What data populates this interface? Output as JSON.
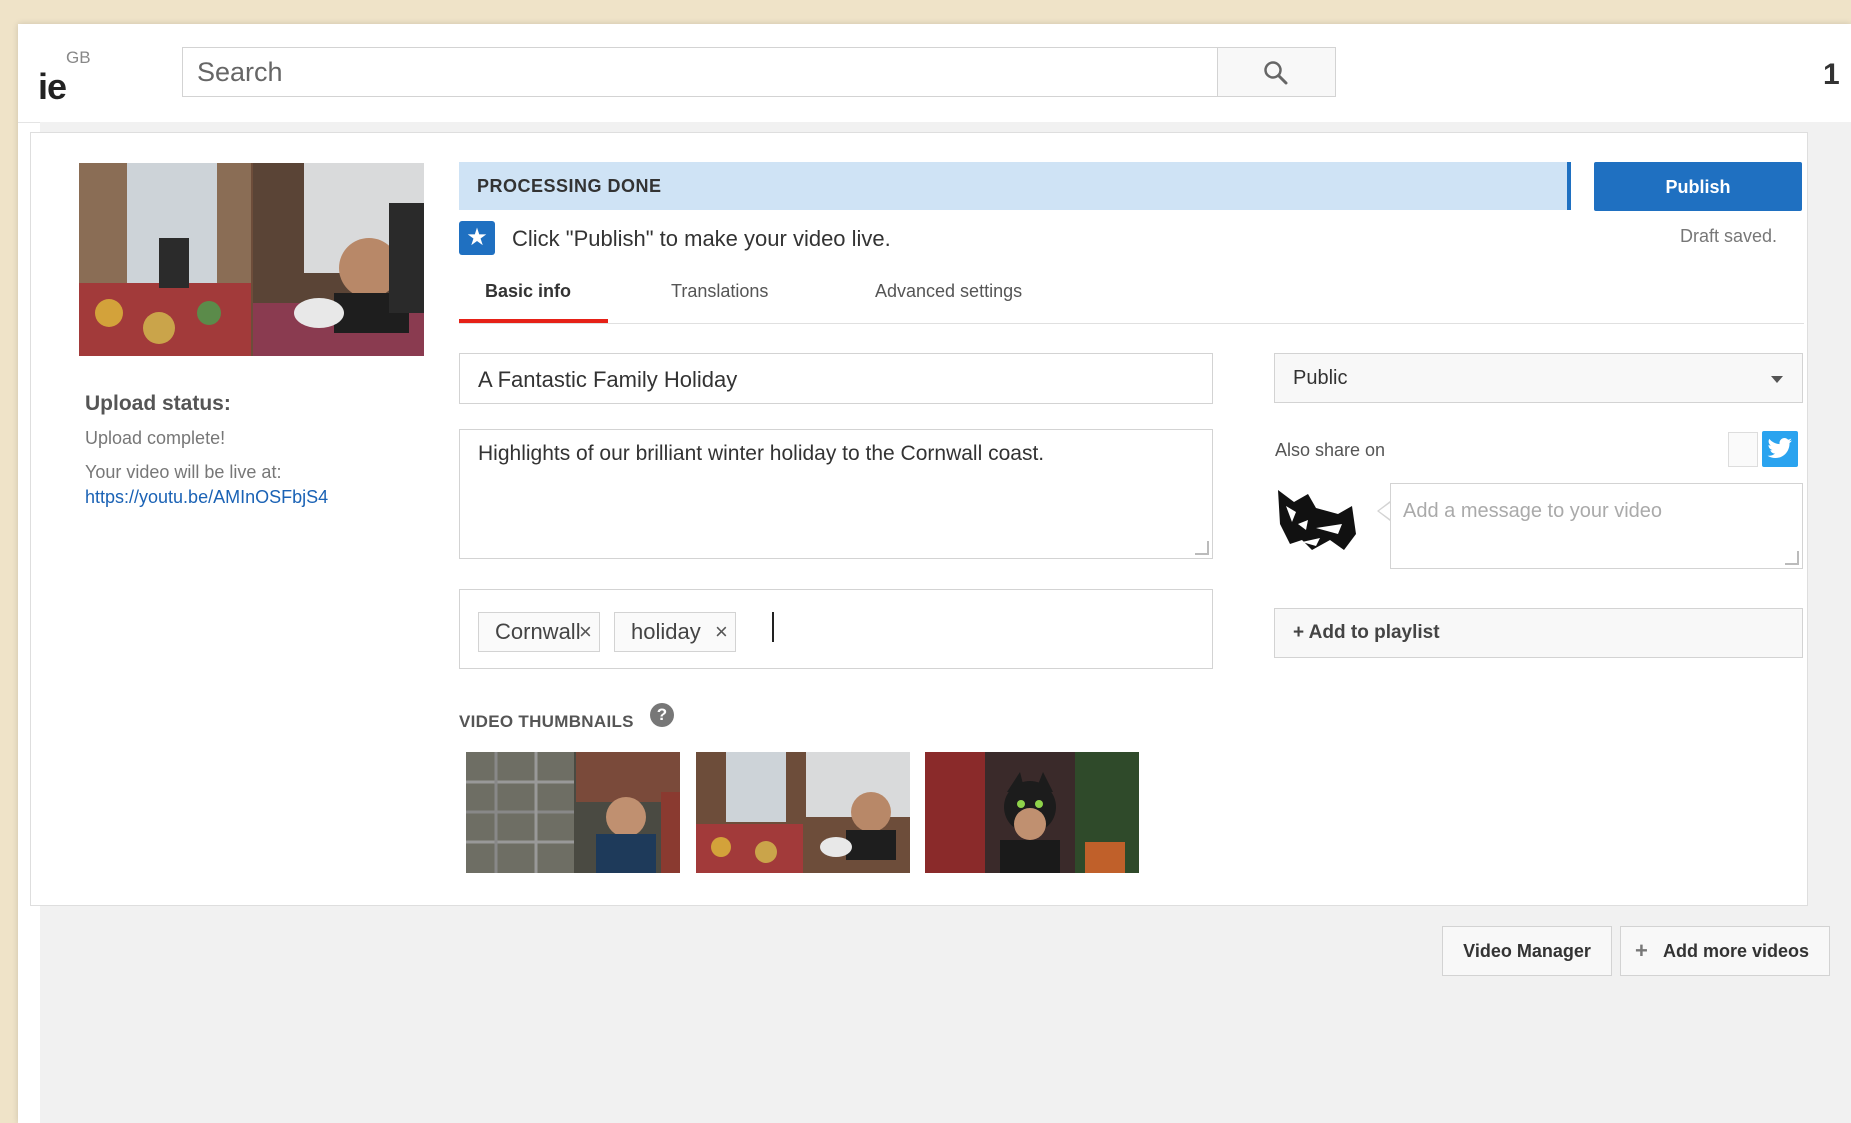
{
  "header": {
    "logo_text": "ie",
    "logo_region": "GB",
    "search_placeholder": "Search",
    "search_icon": "search-icon",
    "corner_glyph": "1"
  },
  "sidebar": {
    "upload_status_label": "Upload status:",
    "upload_complete": "Upload complete!",
    "live_at_label": "Your video will be live at:",
    "video_url": "https://youtu.be/AMInOSFbjS4"
  },
  "status": {
    "processing_text": "PROCESSING DONE",
    "publish_label": "Publish",
    "draft_saved": "Draft saved.",
    "hint": "Click \"Publish\" to make your video live.",
    "accent_color": "#1f70c1",
    "bar_color": "#cfe3f5"
  },
  "tabs": [
    {
      "label": "Basic info",
      "active": true
    },
    {
      "label": "Translations",
      "active": false
    },
    {
      "label": "Advanced settings",
      "active": false
    }
  ],
  "form": {
    "title_value": "A Fantastic Family Holiday",
    "description_value": "Highlights of our brilliant winter holiday to the Cornwall coast.",
    "tags": [
      "Cornwall",
      "holiday"
    ],
    "tag_remove_glyph": "×"
  },
  "right_panel": {
    "privacy_value": "Public",
    "also_share_label": "Also share on",
    "message_placeholder": "Add a message to your video",
    "add_to_playlist_label": "+ Add to playlist",
    "twitter_color": "#2aa3ef"
  },
  "thumbnails": {
    "label": "VIDEO THUMBNAILS",
    "help_glyph": "?"
  },
  "footer": {
    "video_manager_label": "Video Manager",
    "add_more_plus": "+",
    "add_more_label": "Add more videos"
  }
}
